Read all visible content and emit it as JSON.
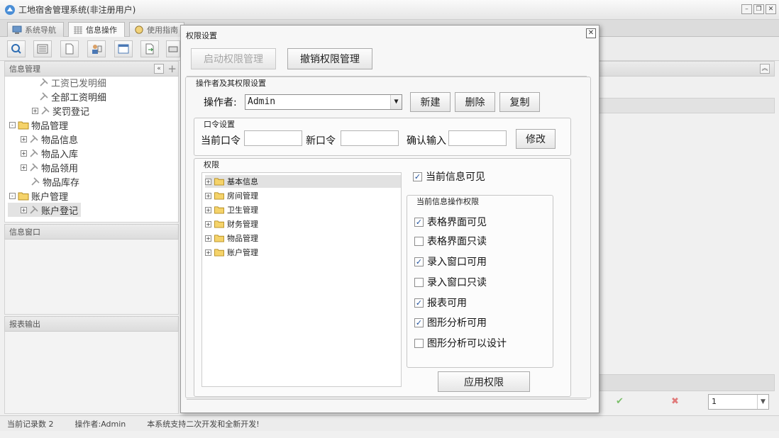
{
  "app": {
    "title": "工地宿舍管理系统(非注册用户)"
  },
  "tabs": [
    {
      "label": "系统导航"
    },
    {
      "label": "信息操作"
    },
    {
      "label": "使用指南"
    }
  ],
  "left_panel": {
    "info_mgmt_header": "信息管理",
    "tree": [
      {
        "label": "工资已发明细",
        "level": 3,
        "expander": ""
      },
      {
        "label": "全部工资明细",
        "level": 3,
        "expander": ""
      },
      {
        "label": "奖罚登记",
        "level": 2,
        "expander": "+"
      },
      {
        "label": "物品管理",
        "level": 1,
        "expander": "-"
      },
      {
        "label": "物品信息",
        "level": 2,
        "expander": "+"
      },
      {
        "label": "物品入库",
        "level": 2,
        "expander": "+"
      },
      {
        "label": "物品领用",
        "level": 2,
        "expander": "+"
      },
      {
        "label": "物品库存",
        "level": 2,
        "expander": ""
      },
      {
        "label": "账户管理",
        "level": 1,
        "expander": "-"
      },
      {
        "label": "账户登记",
        "level": 2,
        "expander": "+"
      }
    ],
    "info_window_header": "信息窗口",
    "report_header": "报表输出"
  },
  "right_panel": {
    "page_value": "1"
  },
  "status": {
    "record_count": "当前记录数 2",
    "operator": "操作者:Admin",
    "note": "本系统支持二次开发和全新开发!"
  },
  "dialog": {
    "title": "权限设置",
    "start_btn": "启动权限管理",
    "revoke_btn": "撤销权限管理",
    "operator_group": "操作者及其权限设置",
    "operator_label": "操作者:",
    "operator_value": "Admin",
    "new_btn": "新建",
    "delete_btn": "删除",
    "copy_btn": "复制",
    "password_group": "口令设置",
    "current_pw_label": "当前口令",
    "new_pw_label": "新口令",
    "confirm_label": "确认输入",
    "modify_btn": "修改",
    "perm_group": "权限",
    "perm_tree": [
      {
        "label": "基本信息",
        "selected": true
      },
      {
        "label": "房间管理",
        "selected": false
      },
      {
        "label": "卫生管理",
        "selected": false
      },
      {
        "label": "财务管理",
        "selected": false
      },
      {
        "label": "物品管理",
        "selected": false
      },
      {
        "label": "账户管理",
        "selected": false
      }
    ],
    "visible_check": {
      "label": "当前信息可见",
      "checked": true
    },
    "ops_group": "当前信息操作权限",
    "ops": [
      {
        "label": "表格界面可见",
        "checked": true
      },
      {
        "label": "表格界面只读",
        "checked": false
      },
      {
        "label": "录入窗口可用",
        "checked": true
      },
      {
        "label": "录入窗口只读",
        "checked": false
      },
      {
        "label": "报表可用",
        "checked": true
      },
      {
        "label": "图形分析可用",
        "checked": true
      },
      {
        "label": "图形分析可以设计",
        "checked": false
      }
    ],
    "apply_btn": "应用权限"
  }
}
